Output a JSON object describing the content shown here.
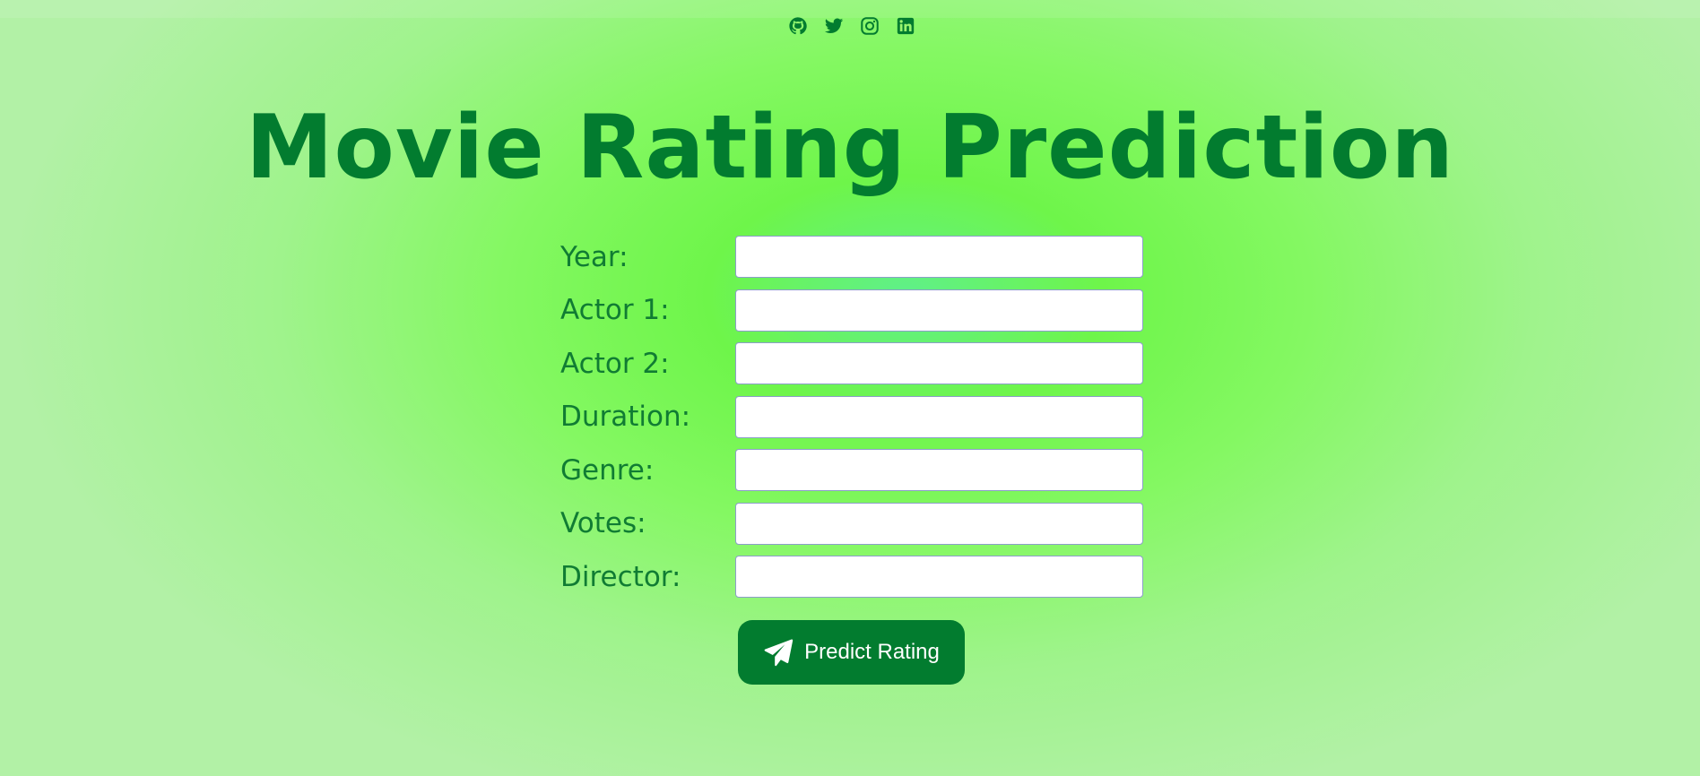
{
  "page": {
    "title": "Movie Rating Prediction"
  },
  "social_links": [
    {
      "name": "github",
      "icon": "github-icon"
    },
    {
      "name": "twitter",
      "icon": "twitter-icon"
    },
    {
      "name": "instagram",
      "icon": "instagram-icon"
    },
    {
      "name": "linkedin",
      "icon": "linkedin-icon"
    }
  ],
  "form": {
    "fields": [
      {
        "label": "Year:",
        "value": "",
        "placeholder": ""
      },
      {
        "label": "Actor 1:",
        "value": "",
        "placeholder": ""
      },
      {
        "label": "Actor 2:",
        "value": "",
        "placeholder": ""
      },
      {
        "label": "Duration:",
        "value": "",
        "placeholder": ""
      },
      {
        "label": "Genre:",
        "value": "",
        "placeholder": ""
      },
      {
        "label": "Votes:",
        "value": "",
        "placeholder": ""
      },
      {
        "label": "Director:",
        "value": "",
        "placeholder": ""
      }
    ],
    "submit_label": "Predict Rating",
    "submit_icon": "paper-plane-icon"
  },
  "colors": {
    "brand": "#027c2f",
    "label": "#107c33",
    "background_center": "#6ef54a",
    "background_edge": "#b2f1a6"
  }
}
